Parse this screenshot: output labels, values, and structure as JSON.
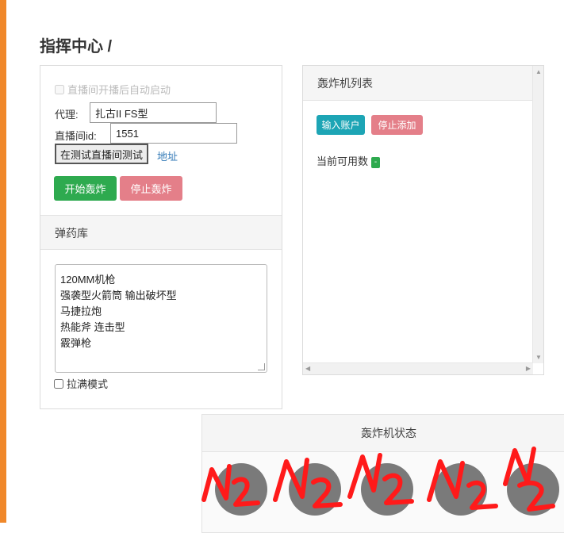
{
  "page": {
    "title": "指挥中心 /",
    "accent_color": "#f0882a"
  },
  "control": {
    "autostart_label": "直播间开播后自动启动",
    "agent_label": "代理:",
    "agent_value": "扎古II FS型",
    "room_label": "直播间id:",
    "room_value": "1551",
    "test_button": "在测试直播间测试",
    "address_link": "地址",
    "start_button": "开始轰炸",
    "stop_button": "停止轰炸"
  },
  "ammo": {
    "title": "弹药库",
    "lines": [
      "120MM机枪",
      "强袭型火箭筒 输出破坏型",
      "马捷拉炮",
      "热能斧 连击型",
      "霰弹枪"
    ],
    "fill_mode_label": "拉满模式"
  },
  "bomber": {
    "title": "轰炸机列表",
    "input_account_button": "输入账户",
    "stop_add_button": "停止添加",
    "available_label": "当前可用数",
    "available_badge": "-"
  },
  "status": {
    "title": "轰炸机状态",
    "circles": [
      "N2",
      "N2",
      "N2",
      "N2",
      "N2"
    ],
    "scribble_color": "#ff1a1a"
  }
}
